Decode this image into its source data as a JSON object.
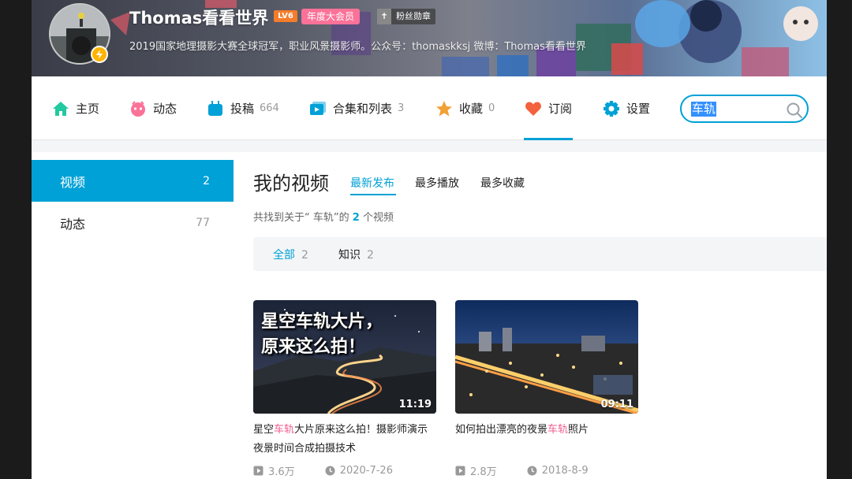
{
  "profile": {
    "username": "Thomas看看世界",
    "level": "LV6",
    "vip": "年度大会员",
    "fan_badge": "粉丝勋章",
    "bio": "2019国家地理摄影大赛全球冠军，职业风景摄影师。公众号：thomaskksj 微博：Thomas看看世界"
  },
  "nav": {
    "items": [
      {
        "label": "主页",
        "count": "",
        "icon": "home-icon",
        "color": "#23c9a0"
      },
      {
        "label": "动态",
        "count": "",
        "icon": "dynamic-icon",
        "color": "#fb7299"
      },
      {
        "label": "投稿",
        "count": "664",
        "icon": "upload-icon",
        "color": "#00a1d6"
      },
      {
        "label": "合集和列表",
        "count": "3",
        "icon": "collection-icon",
        "color": "#00a1d6"
      },
      {
        "label": "收藏",
        "count": "0",
        "icon": "star-icon",
        "color": "#f3a034"
      },
      {
        "label": "订阅",
        "count": "",
        "icon": "heart-icon",
        "color": "#f3613f"
      },
      {
        "label": "设置",
        "count": "",
        "icon": "gear-icon",
        "color": "#00a1d6"
      }
    ],
    "search_value": "车轨"
  },
  "sidebar": {
    "items": [
      {
        "label": "视频",
        "count": "2"
      },
      {
        "label": "动态",
        "count": "77"
      }
    ]
  },
  "main": {
    "title": "我的视频",
    "sort_tabs": [
      "最新发布",
      "最多播放",
      "最多收藏"
    ],
    "result_prefix": "共找到关于“ 车轨”的",
    "result_count": "2",
    "result_suffix": "个视频",
    "filters": [
      {
        "label": "全部",
        "count": "2"
      },
      {
        "label": "知识",
        "count": "2"
      }
    ]
  },
  "videos": [
    {
      "thumb_caption_line1": "星空车轨大片，",
      "thumb_caption_line2": "原来这么拍！",
      "duration": "11:19",
      "title_pre": "星空",
      "title_hl": "车轨",
      "title_post": "大片原来这么拍！摄影师演示夜景时间合成拍摄技术",
      "plays": "3.6万",
      "date": "2020-7-26"
    },
    {
      "duration": "09:11",
      "title_pre": "如何拍出漂亮的夜景",
      "title_hl": "车轨",
      "title_post": "照片",
      "plays": "2.8万",
      "date": "2018-8-9"
    }
  ],
  "colors": {
    "accent": "#00a1d6",
    "highlight": "#f25d8e",
    "vip": "#fb7299"
  }
}
